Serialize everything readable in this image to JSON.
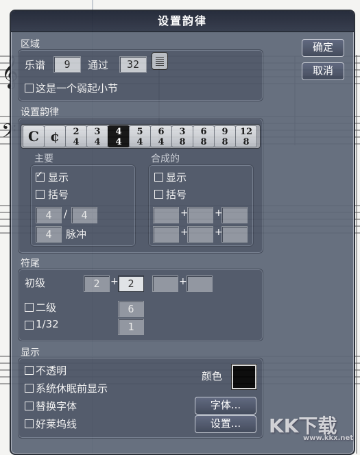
{
  "dialog": {
    "title": "设置韵律",
    "ok_label": "确定",
    "cancel_label": "取消"
  },
  "region": {
    "section_label": "区域",
    "score_label": "乐谱",
    "score_value": "9",
    "through_label": "通过",
    "through_value": "32",
    "pickup_label": "这是一个弱起小节",
    "pickup_checked": false
  },
  "meter": {
    "section_label": "设置韵律",
    "time_signatures": [
      {
        "id": "common",
        "top": "C",
        "bottom": ""
      },
      {
        "id": "cut",
        "top": "¢",
        "bottom": ""
      },
      {
        "id": "2-4",
        "top": "2",
        "bottom": "4"
      },
      {
        "id": "3-4",
        "top": "3",
        "bottom": "4"
      },
      {
        "id": "4-4",
        "top": "4",
        "bottom": "4",
        "selected": true
      },
      {
        "id": "5-4",
        "top": "5",
        "bottom": "4"
      },
      {
        "id": "6-4",
        "top": "6",
        "bottom": "4"
      },
      {
        "id": "3-8",
        "top": "3",
        "bottom": "8"
      },
      {
        "id": "6-8",
        "top": "6",
        "bottom": "8"
      },
      {
        "id": "9-8",
        "top": "9",
        "bottom": "8"
      },
      {
        "id": "12-8",
        "top": "12",
        "bottom": "8"
      }
    ],
    "primary": {
      "label": "主要",
      "show_label": "显示",
      "show_checked": true,
      "bracket_label": "括号",
      "bracket_checked": false,
      "numerator": "4",
      "slash": "/",
      "denominator": "4",
      "pulse_value": "4",
      "pulse_label": "脉冲"
    },
    "composite": {
      "label": "合成的",
      "show_label": "显示",
      "bracket_label": "括号"
    }
  },
  "beaming": {
    "section_label": "符尾",
    "primary_label": "初级",
    "primary_values": [
      "2",
      "2",
      "",
      ""
    ],
    "secondary_label": "二级",
    "secondary_value": "6",
    "thirtysecond_label": "1/32",
    "thirtysecond_value": "1"
  },
  "display": {
    "section_label": "显示",
    "opaque_label": "不透明",
    "show_before_rest_label": "系统休眠前显示",
    "alt_font_label": "替换字体",
    "hollywood_label": "好莱坞线",
    "color_label": "颜色",
    "color_value": "#000000",
    "font_button": "字体...",
    "settings_button": "设置..."
  },
  "watermark": {
    "text": "KK下载",
    "subtext": "www.kkx.net"
  },
  "icons": {
    "plus_glyph": "+"
  }
}
